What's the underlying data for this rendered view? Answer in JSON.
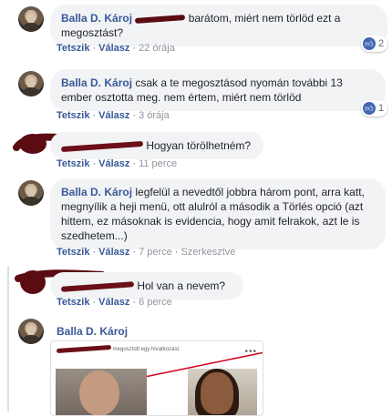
{
  "colors": {
    "link": "#385898",
    "bubble": "#f2f3f5",
    "like": "#4267b2",
    "redaction": "#5a0c12"
  },
  "comments": [
    {
      "author": "Balla D. Károj",
      "text": " barátom, miért nem törlöd ezt a megosztást?",
      "actions": [
        "Tetszik",
        "Válasz"
      ],
      "time": "22 órája",
      "reaction_count": "2"
    },
    {
      "author": "Balla D. Károj",
      "text": "csak a te megosztásod nyomán további 13 ember osztotta meg. nem értem, miért nem törlöd",
      "actions": [
        "Tetszik",
        "Válasz"
      ],
      "time": "3 órája",
      "reaction_count": "1"
    },
    {
      "author": "",
      "text": "Hogyan törölhetném?",
      "actions": [
        "Tetszik",
        "Válasz"
      ],
      "time": "11 perce"
    },
    {
      "author": "Balla D. Károj",
      "text": "legfelül a nevedtől jobbra három pont, arra katt, megnyílik a heji menü, ott alulról a második a Törlés opció (azt hittem, ez másoknak is evidencia, hogy amit felrakok, azt le is szedhetem...)",
      "actions": [
        "Tetszik",
        "Válasz"
      ],
      "time": "7 perce",
      "edited": "Szerkesztve"
    },
    {
      "author": "",
      "text": "Hol van a nevem?",
      "actions": [
        "Tetszik",
        "Válasz"
      ],
      "time": "6 perce"
    },
    {
      "author": "Balla D. Károj",
      "shared_card_text": "megosztott egy hivatkozást.",
      "shared_card_menu": "•••"
    }
  ]
}
